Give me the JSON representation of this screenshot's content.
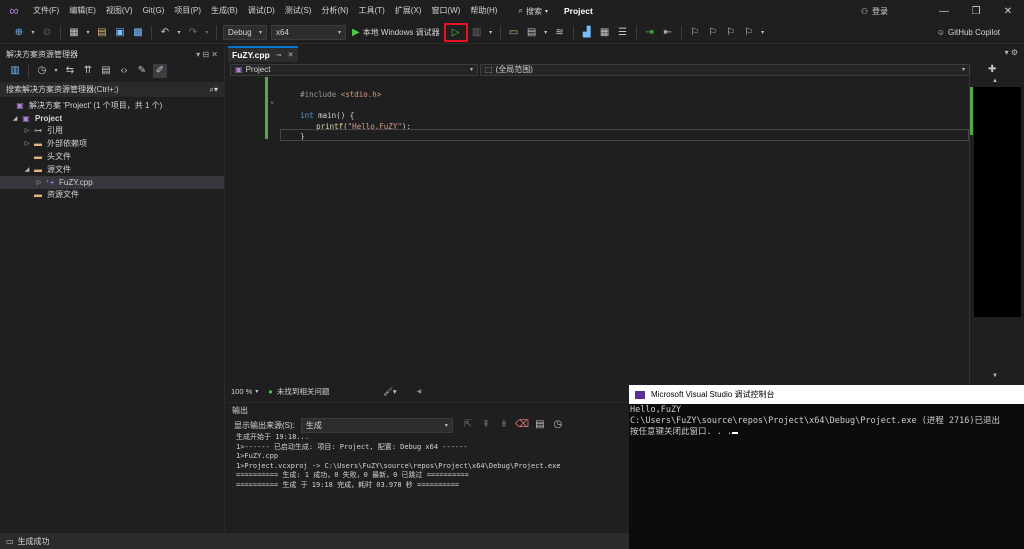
{
  "menu": {
    "items": [
      "文件(F)",
      "编辑(E)",
      "视图(V)",
      "Git(G)",
      "项目(P)",
      "生成(B)",
      "调试(D)",
      "测试(S)",
      "分析(N)",
      "工具(T)",
      "扩展(X)",
      "窗口(W)",
      "帮助(H)"
    ],
    "search_label": "搜索",
    "project_title": "Project",
    "login_label": "登录"
  },
  "toolbar": {
    "config": "Debug",
    "platform": "x64",
    "run_label": "本地 Windows 调试器",
    "copilot_label": "GitHub Copilot"
  },
  "solution_explorer": {
    "title": "解决方案资源管理器",
    "search_placeholder": "搜索解决方案资源管理器(Ctrl+;)",
    "tree": [
      {
        "label": "解决方案 'Project' (1 个项目，共 1 个)",
        "icon": "solution-icon",
        "level": 0
      },
      {
        "label": "Project",
        "icon": "project-icon",
        "level": 1
      },
      {
        "label": "引用",
        "icon": "references-icon",
        "level": 2
      },
      {
        "label": "外部依赖项",
        "icon": "folder-icon",
        "level": 2
      },
      {
        "label": "头文件",
        "icon": "folder-icon",
        "level": 2
      },
      {
        "label": "源文件",
        "icon": "folder-icon",
        "level": 2
      },
      {
        "label": "FuZY.cpp",
        "icon": "cpp-file-icon",
        "level": 3
      },
      {
        "label": "资源文件",
        "icon": "folder-icon",
        "level": 2
      }
    ]
  },
  "editor": {
    "tab_label": "FuZY.cpp",
    "nav_project": "Project",
    "nav_scope": "(全局范围)",
    "code": {
      "include_directive": "#include",
      "include_file": "<stdio.h>",
      "main_kw": "int",
      "main_sig": " main() {",
      "printf_fn": "printf",
      "printf_open": "(",
      "printf_str": "\"Hello,FuZY\"",
      "printf_close": ");",
      "close_brace": "}"
    },
    "zoom": "100 %",
    "issues_label": "未找到相关问题"
  },
  "output": {
    "title": "输出",
    "source_label": "显示输出来源(S):",
    "source_value": "生成",
    "lines": [
      "生成开始于 19:18...",
      "1>------ 已启动生成: 项目: Project, 配置: Debug x64 ------",
      "1>FuZY.cpp",
      "1>Project.vcxproj -> C:\\Users\\FuZY\\source\\repos\\Project\\x64\\Debug\\Project.exe",
      "========== 生成: 1 成功，0 失败，0 最新，0 已跳过 ==========",
      "========== 生成 于 19:18 完成，耗时 03.978 秒 =========="
    ]
  },
  "console": {
    "title": "Microsoft Visual Studio 调试控制台",
    "lines": [
      "Hello,FuZY",
      "C:\\Users\\FuZY\\source\\repos\\Project\\x64\\Debug\\Project.exe (进程 2716)已退出",
      "按任意键关闭此窗口. . ."
    ]
  },
  "status": {
    "text": "生成成功"
  }
}
